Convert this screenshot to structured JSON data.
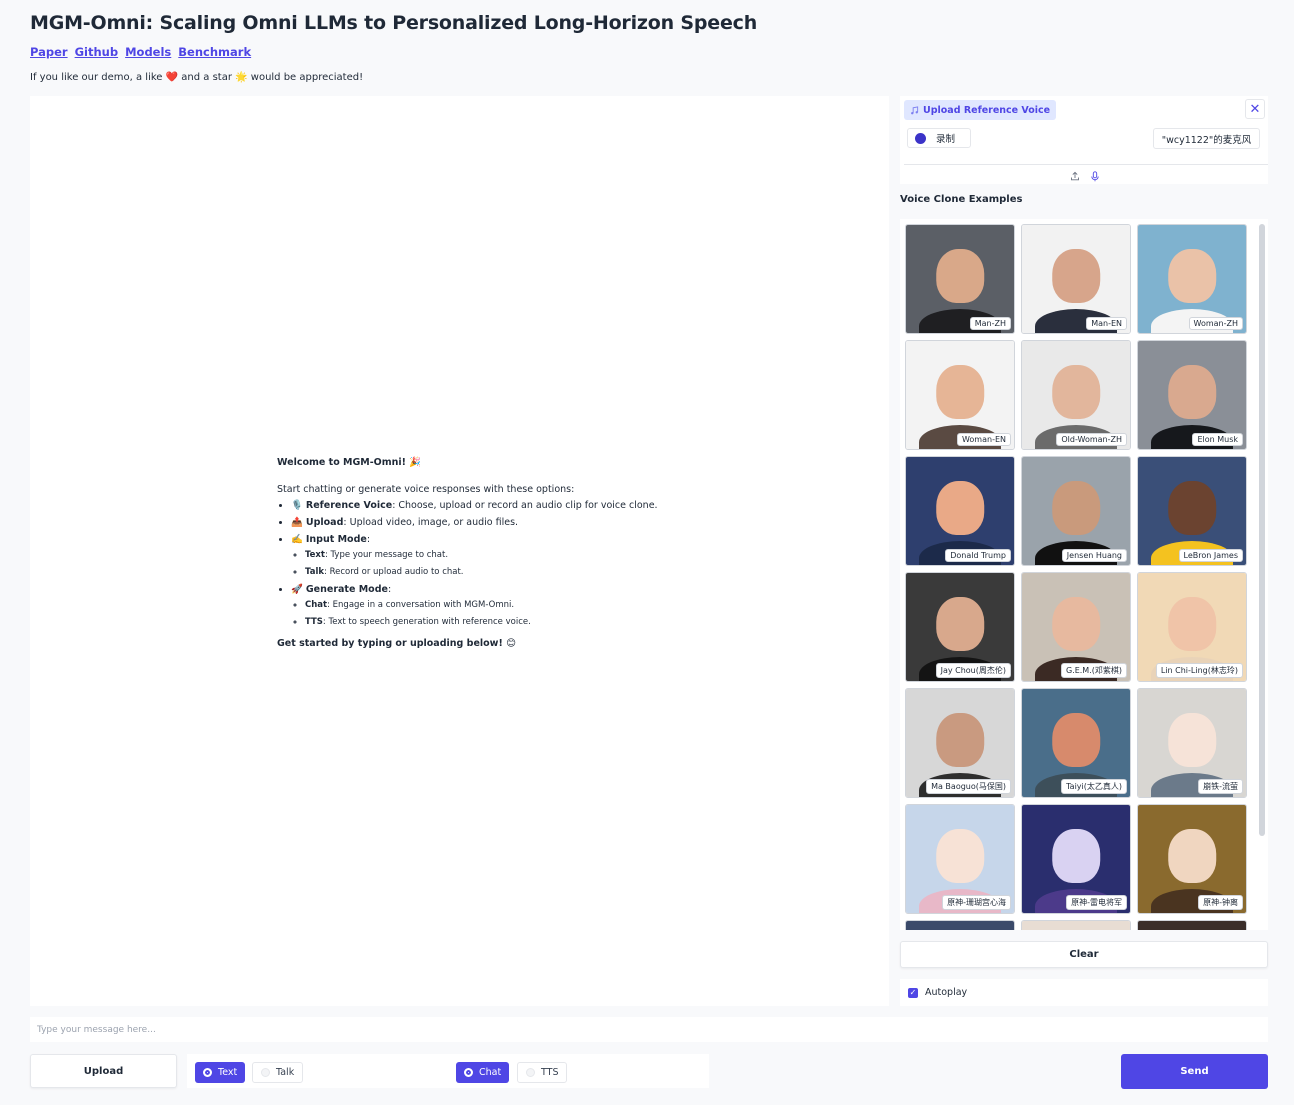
{
  "header": {
    "title": "MGM-Omni: Scaling Omni LLMs to Personalized Long-Horizon Speech",
    "links": [
      {
        "label": "Paper"
      },
      {
        "label": "Github"
      },
      {
        "label": "Models"
      },
      {
        "label": "Benchmark"
      }
    ],
    "tagline_before": "If you like our demo, a like",
    "tagline_heart": "❤️",
    "tagline_middle": "and a star",
    "tagline_star": "🌟",
    "tagline_after": "would be appreciated!"
  },
  "welcome": {
    "title": "Welcome to MGM-Omni! 🎉",
    "intro": "Start chatting or generate voice responses with these options:",
    "items": [
      {
        "icon": "🎙️",
        "label": "Reference Voice",
        "text": ": Choose, upload or record an audio clip for voice clone."
      },
      {
        "icon": "📤",
        "label": "Upload",
        "text": ": Upload video, image, or audio files."
      },
      {
        "icon": "✍️",
        "label": "Input Mode",
        "text": ":"
      },
      {
        "icon": "🚀",
        "label": "Generate Mode",
        "text": ":"
      }
    ],
    "input_mode_subitems": [
      {
        "label": "Text",
        "text": ": Type your message to chat."
      },
      {
        "label": "Talk",
        "text": ": Record or upload audio to chat."
      }
    ],
    "generate_mode_subitems": [
      {
        "label": "Chat",
        "text": ": Engage in a conversation with MGM-Omni."
      },
      {
        "label": "TTS",
        "text": ": Text to speech generation with reference voice."
      }
    ],
    "outro": "Get started by typing or uploading below! 😊"
  },
  "reference_voice": {
    "label": "Upload Reference Voice",
    "record_label": "录制",
    "mic_device": "\"wcy1122\"的麦克风",
    "icons": [
      "music-note-icon",
      "close-icon",
      "upload-icon",
      "microphone-icon"
    ]
  },
  "voice_clone": {
    "title": "Voice Clone Examples",
    "examples": [
      {
        "caption": "Man-ZH",
        "bg": "#5b5f66",
        "skin": "#d9a889",
        "cloth": "#1f1f22"
      },
      {
        "caption": "Man-EN",
        "bg": "#f2f2f2",
        "skin": "#d7a58b",
        "cloth": "#2a2f3d"
      },
      {
        "caption": "Woman-ZH",
        "bg": "#7fb2cf",
        "skin": "#eac2a8",
        "cloth": "#f4f4f4"
      },
      {
        "caption": "Woman-EN",
        "bg": "#f3f3f3",
        "skin": "#e6b596",
        "cloth": "#5a4a42"
      },
      {
        "caption": "Old-Woman-ZH",
        "bg": "#e9e9e9",
        "skin": "#e2b69c",
        "cloth": "#6b6b6b"
      },
      {
        "caption": "Elon Musk",
        "bg": "#8a8f97",
        "skin": "#d9a98f",
        "cloth": "#16181c"
      },
      {
        "caption": "Donald Trump",
        "bg": "#2e3f6e",
        "skin": "#e9a987",
        "cloth": "#1c2a4a"
      },
      {
        "caption": "Jensen Huang",
        "bg": "#9aa3ab",
        "skin": "#c99a7c",
        "cloth": "#111111"
      },
      {
        "caption": "LeBron James",
        "bg": "#3a4f78",
        "skin": "#6b4330",
        "cloth": "#f4c21f"
      },
      {
        "caption": "Jay Chou(周杰伦)",
        "bg": "#3a3a3a",
        "skin": "#d8a88c",
        "cloth": "#141414"
      },
      {
        "caption": "G.E.M.(邓紫棋)",
        "bg": "#c9c1b6",
        "skin": "#e7b99f",
        "cloth": "#3b2a24"
      },
      {
        "caption": "Lin Chi-Ling(林志玲)",
        "bg": "#f1d9b6",
        "skin": "#f0c4a8",
        "cloth": "#e9d3b8"
      },
      {
        "caption": "Ma Baoguo(马保国)",
        "bg": "#d7d7d7",
        "skin": "#c99a80",
        "cloth": "#2e2e2e"
      },
      {
        "caption": "Taiyi(太乙真人)",
        "bg": "#4a6e8a",
        "skin": "#d78a6c",
        "cloth": "#3d4f5a"
      },
      {
        "caption": "崩铁-流萤",
        "bg": "#d8d6d2",
        "skin": "#f6e3d8",
        "cloth": "#6b7a8a"
      },
      {
        "caption": "原神-珊瑚宫心海",
        "bg": "#c6d6ea",
        "skin": "#f7e2d6",
        "cloth": "#e8b8c8"
      },
      {
        "caption": "原神-雷电将军",
        "bg": "#2a2e6e",
        "skin": "#d9d2f2",
        "cloth": "#4c3a8a"
      },
      {
        "caption": "原神-钟离",
        "bg": "#8a6a2e",
        "skin": "#f0d6c0",
        "cloth": "#4a3420"
      },
      {
        "caption": "",
        "bg": "#3b4a6a",
        "skin": "#cfd6e6",
        "cloth": "#3b4a6a"
      },
      {
        "caption": "",
        "bg": "#e8ddd3",
        "skin": "#f2d8c6",
        "cloth": "#e8ddd3"
      },
      {
        "caption": "",
        "bg": "#3a2e2a",
        "skin": "#d9b99a",
        "cloth": "#3a2e2a"
      }
    ]
  },
  "controls": {
    "clear_label": "Clear",
    "autoplay_label": "Autoplay",
    "message_placeholder": "Type your message here...",
    "upload_label": "Upload",
    "input_mode_options": [
      {
        "label": "Text",
        "selected": true
      },
      {
        "label": "Talk",
        "selected": false
      }
    ],
    "generate_mode_options": [
      {
        "label": "Chat",
        "selected": true
      },
      {
        "label": "TTS",
        "selected": false
      }
    ],
    "send_label": "Send"
  },
  "colors": {
    "accent": "#4f46e5",
    "background": "#f8f9fb",
    "panel": "#ffffff"
  }
}
